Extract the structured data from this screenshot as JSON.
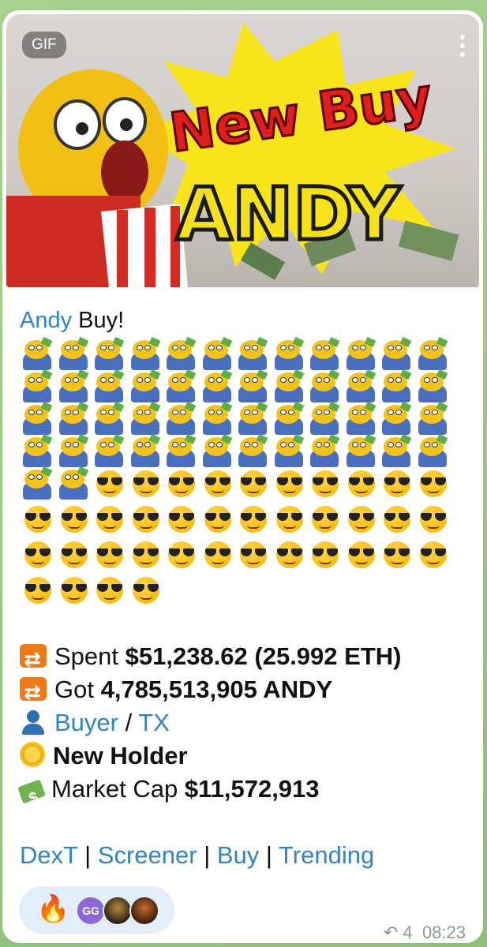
{
  "media": {
    "badge": "GIF",
    "headline_top": "New Buy",
    "headline_bottom": "ANDY"
  },
  "message": {
    "token_name": "Andy",
    "title_suffix": " Buy!",
    "emoji_pepe_count": 50,
    "emoji_cool_count": 38,
    "stats": {
      "spent_label": "Spent ",
      "spent_value": "$51,238.62 (25.992 ETH)",
      "got_label": "Got ",
      "got_value": "4,785,513,905 ANDY",
      "buyer_link": "Buyer",
      "separator": " / ",
      "tx_link": "TX",
      "holder_text": "New Holder",
      "mcap_label": "Market Cap ",
      "mcap_value": "$11,572,913"
    },
    "links": {
      "dext": "DexT",
      "sep": " | ",
      "screener": "Screener",
      "buy": "Buy",
      "trending": "Trending"
    },
    "reactions": {
      "emoji": "🔥",
      "avatar_initials": "GG"
    },
    "meta": {
      "reply_count": "4",
      "time": "08:23"
    }
  }
}
